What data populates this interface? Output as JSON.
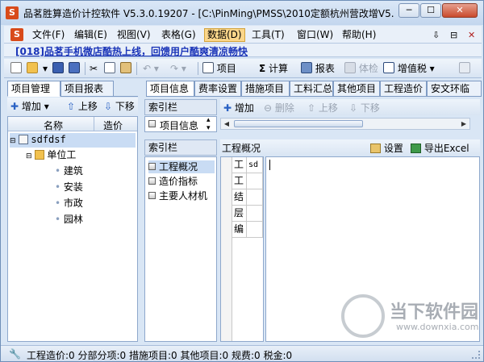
{
  "window": {
    "logo_glyph": "S",
    "title": "品茗胜算造价计控软件   V5.3.0.19207 - [C:\\PinMing\\PMSS\\2010定额杭州营改增V5..."
  },
  "window_controls": {
    "minimize": "─",
    "maximize": "☐",
    "close": "✕"
  },
  "menu": {
    "items": [
      "文件(F)",
      "编辑(E)",
      "视图(V)",
      "表格(G)",
      "数据(D)",
      "工具(T)",
      "窗口(W)",
      "帮助(H)"
    ],
    "active": "数据(D)",
    "right_glyphs": [
      "⇩",
      "⊟",
      "✕"
    ]
  },
  "banner": {
    "text": "[018]品茗手机微店酷热上线，回馈用户酷爽清凉畅快"
  },
  "toolbar": {
    "project_label": "项目",
    "calc_label": "计算",
    "sigma": "Σ",
    "report_label": "报表",
    "check_label": "体检",
    "vat_label": "增值税"
  },
  "left_panel": {
    "tabs": [
      "项目管理",
      "项目报表"
    ],
    "toolbar": {
      "add": "增加",
      "up": "上移",
      "down": "下移"
    },
    "columns": {
      "name": "名称",
      "cost": "造价"
    },
    "tree": {
      "root": "sdfdsf",
      "unit": "单位工",
      "children": [
        "建筑",
        "安装",
        "市政",
        "园林"
      ]
    }
  },
  "right_panel": {
    "tabs": [
      "项目信息",
      "费率设置",
      "措施项目",
      "工料汇总",
      "其他项目",
      "工程造价",
      "安文环临"
    ],
    "index_label_top": "索引栏",
    "index_select_value": "项目信息",
    "toolbar": {
      "add": "增加",
      "delete": "删除",
      "up": "上移",
      "down": "下移"
    },
    "index_label_bottom": "索引栏",
    "index_items": [
      "工程概况",
      "造价指标",
      "主要人材机"
    ],
    "overview": {
      "title": "工程概况",
      "settings": "设置",
      "export": "导出Excel",
      "rows": [
        {
          "a": "工",
          "b": "sd"
        },
        {
          "a": "工",
          "b": ""
        },
        {
          "a": "结",
          "b": ""
        },
        {
          "a": "层",
          "b": ""
        },
        {
          "a": "编",
          "b": ""
        }
      ]
    }
  },
  "status": {
    "text": "工程造价:0 分部分项:0 措施项目:0 其他项目:0 规费:0 税金:0"
  },
  "watermark": {
    "text": "当下软件园",
    "url": "www.downxia.com"
  },
  "colors": {
    "accent": "#d84a1a",
    "banner_link": "#1a34b8",
    "frame": "#d9e6f5"
  }
}
